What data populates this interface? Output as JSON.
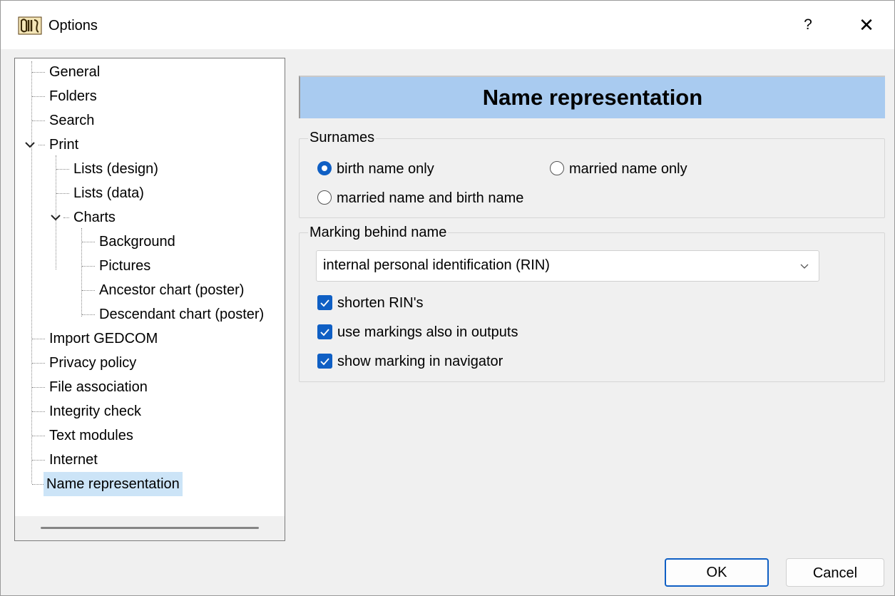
{
  "window": {
    "title": "Options",
    "help_label": "?",
    "close_label": "✕"
  },
  "tree": {
    "items": [
      {
        "label": "General"
      },
      {
        "label": "Folders"
      },
      {
        "label": "Search"
      },
      {
        "label": "Print"
      },
      {
        "label": "Lists (design)"
      },
      {
        "label": "Lists (data)"
      },
      {
        "label": "Charts"
      },
      {
        "label": "Background"
      },
      {
        "label": "Pictures"
      },
      {
        "label": "Ancestor chart (poster)"
      },
      {
        "label": "Descendant chart (poster)"
      },
      {
        "label": "Import GEDCOM"
      },
      {
        "label": "Privacy policy"
      },
      {
        "label": "File association"
      },
      {
        "label": "Integrity check"
      },
      {
        "label": "Text modules"
      },
      {
        "label": "Internet"
      },
      {
        "label": "Name representation"
      }
    ],
    "selected": "Name representation"
  },
  "panel": {
    "header": "Name representation",
    "surnames": {
      "legend": "Surnames",
      "options": [
        {
          "label": "birth name only",
          "checked": true
        },
        {
          "label": "married name only",
          "checked": false
        },
        {
          "label": "married name and birth name",
          "checked": false
        }
      ]
    },
    "marking": {
      "legend": "Marking behind name",
      "selected_value": "internal personal identification (RIN)",
      "checks": [
        {
          "label": "shorten RIN's",
          "checked": true
        },
        {
          "label": "use markings also in outputs",
          "checked": true
        },
        {
          "label": "show marking in navigator",
          "checked": true
        }
      ]
    }
  },
  "buttons": {
    "ok": "OK",
    "cancel": "Cancel"
  },
  "colors": {
    "accent": "#0f5fc4",
    "header_band": "#a9cbf0",
    "selection": "#cce4f7"
  }
}
